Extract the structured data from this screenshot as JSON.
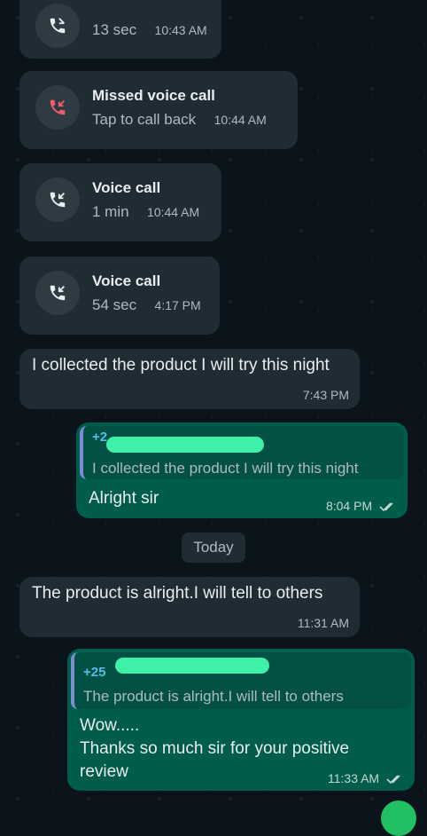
{
  "calls": [
    {
      "title": "",
      "sub": "13 sec",
      "time": "10:43 AM",
      "missed": false
    },
    {
      "title": "Missed voice call",
      "sub": "Tap to call back",
      "time": "10:44 AM",
      "missed": true
    },
    {
      "title": "Voice call",
      "sub": "1 min",
      "time": "10:44 AM",
      "missed": false
    },
    {
      "title": "Voice call",
      "sub": "54 sec",
      "time": "4:17 PM",
      "missed": false
    }
  ],
  "messages": {
    "m1": {
      "text": "I collected the product I will try this night",
      "time": "7:43 PM"
    },
    "m2": {
      "quote_name": "+2",
      "quote_text": "I collected the product I will try this night",
      "text": "Alright sir",
      "time": "8:04 PM"
    },
    "date_divider": "Today",
    "m3": {
      "text": "The product is alright.I will tell to others",
      "time": "11:31 AM"
    },
    "m4": {
      "quote_name": "+25",
      "quote_text": "The product is alright.I will tell to others",
      "text_line1": "Wow.....",
      "text_line2": "Thanks so much sir for your positive review",
      "time": "11:33 AM"
    }
  },
  "icons": {
    "call": "incoming-call-icon",
    "missed": "missed-call-icon",
    "read": "double-check-icon"
  },
  "colors": {
    "incoming_bubble": "#202c33",
    "outgoing_bubble": "#005c4b",
    "missed_red": "#f15c6d",
    "read_ticks": "#c7d6d1"
  }
}
